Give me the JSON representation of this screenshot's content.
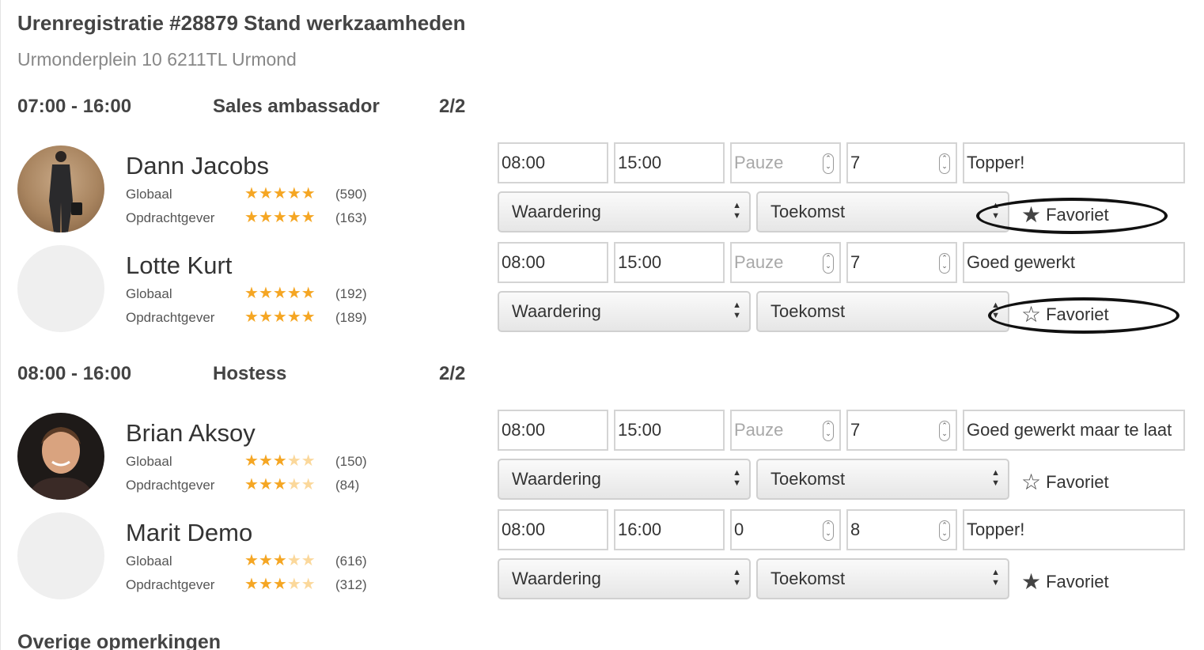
{
  "header": {
    "title": "Urenregistratie #28879 Stand werkzaamheden",
    "address": "Urmonderplein 10 6211TL Urmond"
  },
  "shifts": [
    {
      "time": "07:00 - 16:00",
      "role": "Sales ambassador",
      "count": "2/2",
      "people": [
        {
          "name": "Dann Jacobs",
          "avatar": "photo",
          "global_label": "Globaal",
          "global_rating": 5,
          "global_count": "(590)",
          "client_label": "Opdrachtgever",
          "client_rating": 5,
          "client_count": "(163)",
          "start": "08:00",
          "end": "15:00",
          "pause": "",
          "pause_placeholder": "Pauze",
          "hours": "7",
          "comment": "Topper!",
          "rating_select": "Waardering",
          "future_select": "Toekomst",
          "favorite_label": "Favoriet",
          "favorite": true,
          "highlighted": true
        },
        {
          "name": "Lotte Kurt",
          "avatar": "placeholder",
          "global_label": "Globaal",
          "global_rating": 5,
          "global_count": "(192)",
          "client_label": "Opdrachtgever",
          "client_rating": 5,
          "client_count": "(189)",
          "start": "08:00",
          "end": "15:00",
          "pause": "",
          "pause_placeholder": "Pauze",
          "hours": "7",
          "comment": "Goed gewerkt",
          "rating_select": "Waardering",
          "future_select": "Toekomst",
          "favorite_label": "Favoriet",
          "favorite": false,
          "highlighted": true
        }
      ]
    },
    {
      "time": "08:00 - 16:00",
      "role": "Hostess",
      "count": "2/2",
      "people": [
        {
          "name": "Brian Aksoy",
          "avatar": "photo",
          "global_label": "Globaal",
          "global_rating": 3,
          "global_count": "(150)",
          "client_label": "Opdrachtgever",
          "client_rating": 3,
          "client_count": "(84)",
          "start": "08:00",
          "end": "15:00",
          "pause": "",
          "pause_placeholder": "Pauze",
          "hours": "7",
          "comment": "Goed gewerkt maar te laat",
          "rating_select": "Waardering",
          "future_select": "Toekomst",
          "favorite_label": "Favoriet",
          "favorite": false,
          "highlighted": false
        },
        {
          "name": "Marit Demo",
          "avatar": "placeholder",
          "global_label": "Globaal",
          "global_rating": 3,
          "global_count": "(616)",
          "client_label": "Opdrachtgever",
          "client_rating": 3,
          "client_count": "(312)",
          "start": "08:00",
          "end": "16:00",
          "pause": "0",
          "pause_placeholder": "Pauze",
          "hours": "8",
          "comment": "Topper!",
          "rating_select": "Waardering",
          "future_select": "Toekomst",
          "favorite_label": "Favoriet",
          "favorite": true,
          "highlighted": false
        }
      ]
    }
  ],
  "remarks": {
    "heading": "Overige opmerkingen"
  },
  "colors": {
    "star_on": "#f5a623",
    "star_off": "#fbd89b",
    "annotation": "#111111"
  }
}
